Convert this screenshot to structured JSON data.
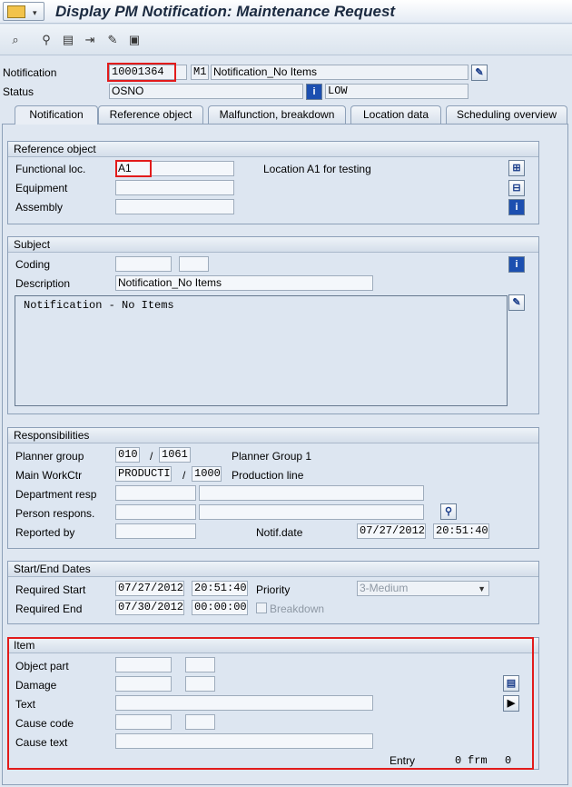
{
  "window": {
    "title": "Display PM Notification: Maintenance Request"
  },
  "toolbar": {
    "icons": [
      "search-icon",
      "binoculars-icon",
      "document-icon",
      "export-icon",
      "settings-icon",
      "print-icon"
    ]
  },
  "header": {
    "notification_label": "Notification",
    "notification_value": "10001364",
    "notification_type": "M1",
    "notification_text": "Notification_No Items",
    "status_label": "Status",
    "status_value": "OSNO",
    "priority_status": "LOW"
  },
  "tabs": [
    {
      "label": "Notification"
    },
    {
      "label": "Reference object"
    },
    {
      "label": "Malfunction, breakdown"
    },
    {
      "label": "Location data"
    },
    {
      "label": "Scheduling overview"
    }
  ],
  "reference_object": {
    "header": "Reference object",
    "functional_loc_label": "Functional loc.",
    "functional_loc_value": "A1",
    "functional_loc_text": "Location A1 for testing",
    "equipment_label": "Equipment",
    "assembly_label": "Assembly"
  },
  "subject": {
    "header": "Subject",
    "coding_label": "Coding",
    "description_label": "Description",
    "description_value": "Notification_No Items",
    "long_text": "Notification - No Items"
  },
  "responsibilities": {
    "header": "Responsibilities",
    "planner_group_label": "Planner group",
    "planner_group_value": "010",
    "planner_plant_value": "1061",
    "planner_group_text": "Planner Group 1",
    "main_workctr_label": "Main WorkCtr",
    "main_workctr_value": "PRODUCTI",
    "main_workctr_plant": "1000",
    "main_workctr_text": "Production line",
    "department_resp_label": "Department resp",
    "person_respons_label": "Person respons.",
    "reported_by_label": "Reported by",
    "notif_date_label": "Notif.date",
    "notif_date_value": "07/27/2012",
    "notif_time_value": "20:51:40",
    "separator": "/"
  },
  "start_end": {
    "header": "Start/End Dates",
    "required_start_label": "Required Start",
    "required_start_date": "07/27/2012",
    "required_start_time": "20:51:40",
    "priority_label": "Priority",
    "priority_value": "3-Medium",
    "required_end_label": "Required End",
    "required_end_date": "07/30/2012",
    "required_end_time": "00:00:00",
    "breakdown_label": "Breakdown"
  },
  "item": {
    "header": "Item",
    "object_part_label": "Object part",
    "damage_label": "Damage",
    "text_label": "Text",
    "cause_code_label": "Cause code",
    "cause_text_label": "Cause text",
    "entry_label": "Entry",
    "entry_value": "0",
    "frm_label": "frm",
    "frm_value": "0"
  }
}
